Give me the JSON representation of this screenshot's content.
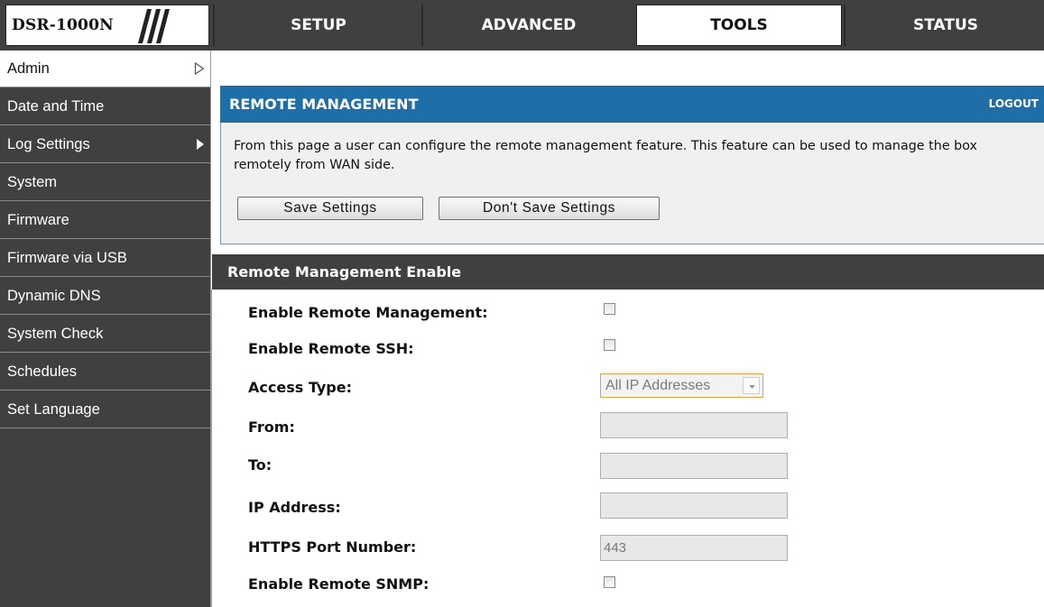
{
  "brand": {
    "model": "DSR-1000N"
  },
  "nav": {
    "tabs": [
      {
        "label": "SETUP",
        "active": false
      },
      {
        "label": "ADVANCED",
        "active": false
      },
      {
        "label": "TOOLS",
        "active": true
      },
      {
        "label": "STATUS",
        "active": false
      }
    ]
  },
  "sidebar": {
    "items": [
      {
        "label": "Admin",
        "active": true,
        "arrow": "outline-right-triangle-icon"
      },
      {
        "label": "Date and Time"
      },
      {
        "label": "Log Settings",
        "arrow": "filled-right-triangle-icon"
      },
      {
        "label": "System"
      },
      {
        "label": "Firmware"
      },
      {
        "label": "Firmware via USB"
      },
      {
        "label": "Dynamic DNS"
      },
      {
        "label": "System Check"
      },
      {
        "label": "Schedules"
      },
      {
        "label": "Set Language"
      }
    ]
  },
  "panel": {
    "title": "REMOTE MANAGEMENT",
    "logout": "LOGOUT",
    "description": "From this page a user can configure the remote management feature. This feature can be used to manage the box remotely from WAN side.",
    "save_label": "Save Settings",
    "dont_save_label": "Don't Save Settings"
  },
  "section": {
    "title": "Remote Management Enable",
    "fields": {
      "enable_remote_management": {
        "label": "Enable Remote Management:",
        "checked": false
      },
      "enable_remote_ssh": {
        "label": "Enable Remote SSH:",
        "checked": false
      },
      "access_type": {
        "label": "Access Type:",
        "value": "All IP Addresses"
      },
      "from": {
        "label": "From:",
        "value": ""
      },
      "to": {
        "label": "To:",
        "value": ""
      },
      "ip_address": {
        "label": "IP Address:",
        "value": ""
      },
      "https_port": {
        "label": "HTTPS Port Number:",
        "value": "443"
      },
      "enable_remote_snmp": {
        "label": "Enable Remote SNMP:",
        "checked": false
      }
    }
  },
  "colors": {
    "topbar": "#404040",
    "header_blue": "#1f6ea7",
    "select_border": "#d9a64a"
  }
}
